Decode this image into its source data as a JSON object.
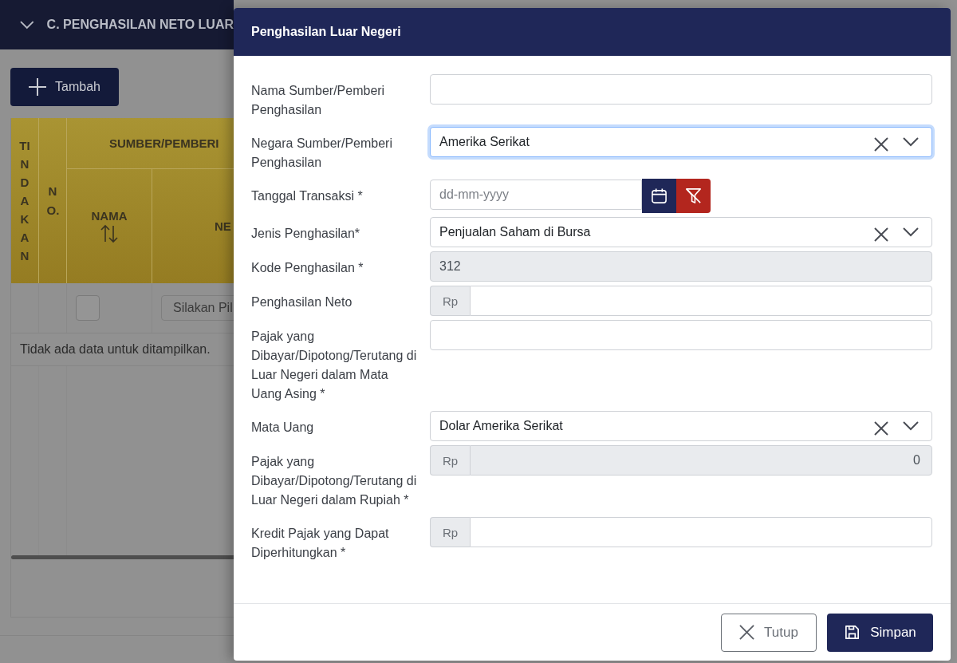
{
  "section": {
    "title": "C. PENGHASILAN NETO LUAR",
    "expanded": true
  },
  "add_button": {
    "label": "Tambah"
  },
  "table": {
    "group_header": "SUMBER/PEMBERI",
    "columns": [
      {
        "label": "TINDAKAN",
        "kind": "vertical"
      },
      {
        "label": "NO.",
        "kind": "vertical"
      },
      {
        "label": "NAMA",
        "kind": "sortable"
      },
      {
        "label": "NE",
        "kind": "plain"
      }
    ],
    "filter_row": {
      "checked": false,
      "select_placeholder": "Silakan Pil"
    },
    "empty_message": "Tidak ada data untuk ditampilkan."
  },
  "dialog": {
    "title": "Penghasilan Luar Negeri",
    "fields": [
      {
        "label": "Nama Sumber/Pemberi Penghasilan",
        "kind": "text",
        "focused": false,
        "disabled": false
      },
      {
        "label": "Negara Sumber/Pemberi Penghasilan",
        "kind": "select",
        "value": "Amerika Serikat",
        "focused": true,
        "disabled": false
      },
      {
        "label": "Tanggal Transaksi *",
        "kind": "date",
        "placeholder": "dd-mm-yyyy",
        "focused": false,
        "disabled": false
      },
      {
        "label": "Jenis Penghasilan*",
        "kind": "select",
        "value": "Penjualan Saham di Bursa",
        "focused": false,
        "disabled": false
      },
      {
        "label": "Kode Penghasilan *",
        "kind": "text",
        "value": "312",
        "focused": false,
        "disabled": true
      },
      {
        "label": "Penghasilan Neto",
        "kind": "currency",
        "prefix": "Rp",
        "focused": false,
        "disabled": false
      },
      {
        "label": "Pajak yang Dibayar/Dipotong/Terutang di Luar Negeri dalam Mata Uang Asing *",
        "kind": "text",
        "focused": false,
        "disabled": false
      },
      {
        "label": "Mata Uang",
        "kind": "select",
        "value": "Dolar Amerika Serikat",
        "focused": false,
        "disabled": false
      },
      {
        "label": "Pajak yang Dibayar/Dipotong/Terutang di Luar Negeri dalam Rupiah *",
        "kind": "currency",
        "prefix": "Rp",
        "value": "0",
        "focused": false,
        "disabled": true
      },
      {
        "label": "Kredit Pajak yang Dapat Diperhitungkan *",
        "kind": "currency",
        "prefix": "Rp",
        "focused": false,
        "disabled": false
      }
    ],
    "buttons": [
      {
        "label": "Tutup",
        "kind": "close"
      },
      {
        "label": "Simpan",
        "kind": "save"
      }
    ]
  }
}
